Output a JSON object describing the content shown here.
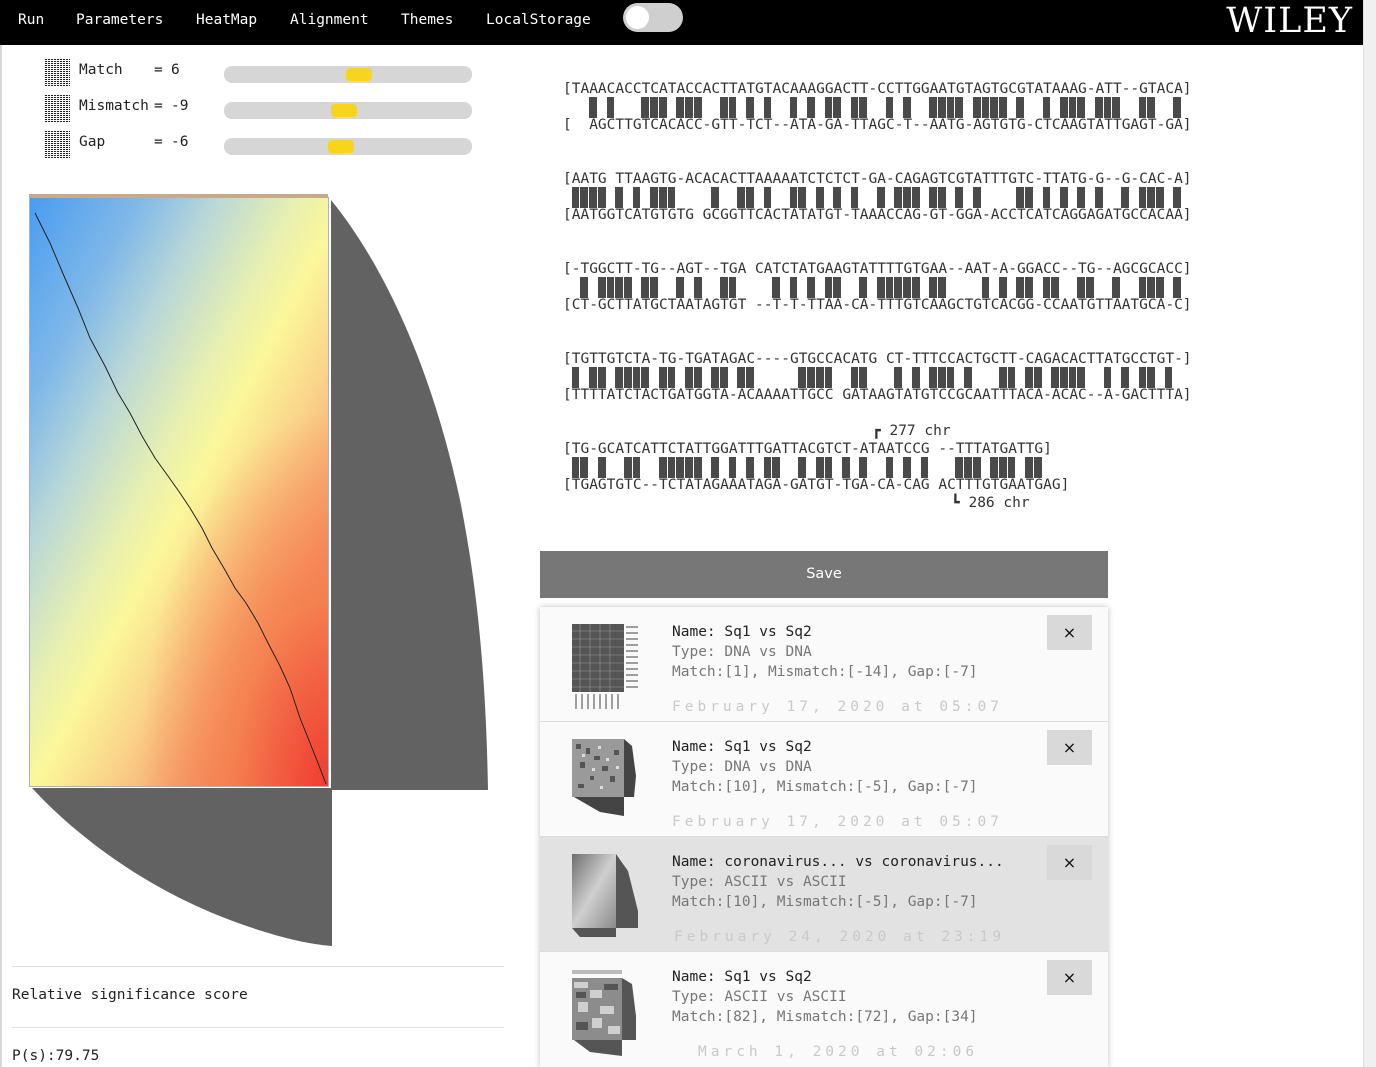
{
  "nav": {
    "items": [
      "Run",
      "Parameters",
      "HeatMap",
      "Alignment",
      "Themes",
      "LocalStorage"
    ],
    "theme_toggle_on": false,
    "logo": "WILEY"
  },
  "params": [
    {
      "label": "Match",
      "eq": "=",
      "value": "6",
      "slider_fraction": 0.55
    },
    {
      "label": "Mismatch",
      "eq": "=",
      "value": "-9",
      "slider_fraction": 0.48
    },
    {
      "label": "Gap",
      "eq": "=",
      "value": "-6",
      "slider_fraction": 0.47
    }
  ],
  "significance": {
    "label": "Relative significance score",
    "value": "P(s):79.75"
  },
  "alignment": {
    "blocks": [
      {
        "top": "[TAAACACCTCATACCACTTATGTACAAAGGACTT-CCTTGGAATGTAGTGCGTATAAAG-ATT--GTACA]",
        "bottom": "[  AGCTTGTCACACC-GTT-TCT--ATA-GA-TTAGC-T--AATG-AGTGTG-CTCAAGTATTGAGT-GA]"
      },
      {
        "top": "[AATG TTAAGTG-ACACACTTAAAAATCTCTCT-GA-CAGAGTCGTATTTGTC-TTATG-G--G-CAC-A]",
        "bottom": "[AATGGTCATGTGTG GCGGTTCACTATATGT-TAAACCAG-GT-GGA-ACCTCATCAGGAGATGCCACAA]"
      },
      {
        "top": "[-TGGCTT-TG--AGT--TGA CATCTATGAAGTATTTTGTGAA--AAT-A-GGACC--TG--AGCGCACC]",
        "bottom": "[CT-GCTTATGCTAATAGTGT --T-T-TTAA-CA-TTTGTCAAGCTGTCACGG-CCAATGTTAATGCA-C]"
      },
      {
        "top": "[TGTTGTCTA-TG-TGATAGAC----GTGCCACATG CT-TTTCCACTGCTT-CAGACACTTATGCCTGT-]",
        "bottom": "[TTTTATCTACTGATGGTA-ACAAAATTGCC GATAAGTATGTCCGCAATTTACA-ACAC--A-GACTTTA]"
      },
      {
        "top": "[TG-GCATCATTCTATTGGATTTGATTACGTCT-ATAATCCG --TTTATGATTG]",
        "bottom": "[TGAGTGTC--TCTATAGAAATAGA-GATGT-TGA-CA-CAG ACTTTGTGAATGAG]"
      }
    ],
    "marker_top": "277 chr",
    "marker_bottom": "286 chr"
  },
  "save_label": "Save",
  "saved": [
    {
      "name": "Name: Sq1 vs Sq2",
      "type": "Type: DNA vs DNA",
      "params": "Match:[1], Mismatch:[-14], Gap:[-7]",
      "date": "February 17, 2020 at 05:07",
      "selected": false,
      "thumb": "dna-grid"
    },
    {
      "name": "Name: Sq1 vs Sq2",
      "type": "Type: DNA vs DNA",
      "params": "Match:[10], Mismatch:[-5], Gap:[-7]",
      "date": "February 17, 2020 at 05:07",
      "selected": false,
      "thumb": "dna-noisy"
    },
    {
      "name": "Name: coronavirus... vs coronavirus...",
      "type": "Type: ASCII vs ASCII",
      "params": "Match:[10], Mismatch:[-5], Gap:[-7]",
      "date": "February 24, 2020 at 23:19",
      "selected": true,
      "thumb": "ascii-smooth"
    },
    {
      "name": "Name: Sq1 vs Sq2",
      "type": "Type: ASCII vs ASCII",
      "params": "Match:[82], Mismatch:[72], Gap:[34]",
      "date": "March 1, 2020 at 02:06",
      "selected": false,
      "thumb": "ascii-blocks"
    }
  ],
  "close_label": "×",
  "colors": {
    "topbar": "#000000",
    "slider_thumb": "#f7d51e",
    "match_bar": "#4a4a4a",
    "save_button": "#777777",
    "selected_item": "#e2e2e2"
  }
}
